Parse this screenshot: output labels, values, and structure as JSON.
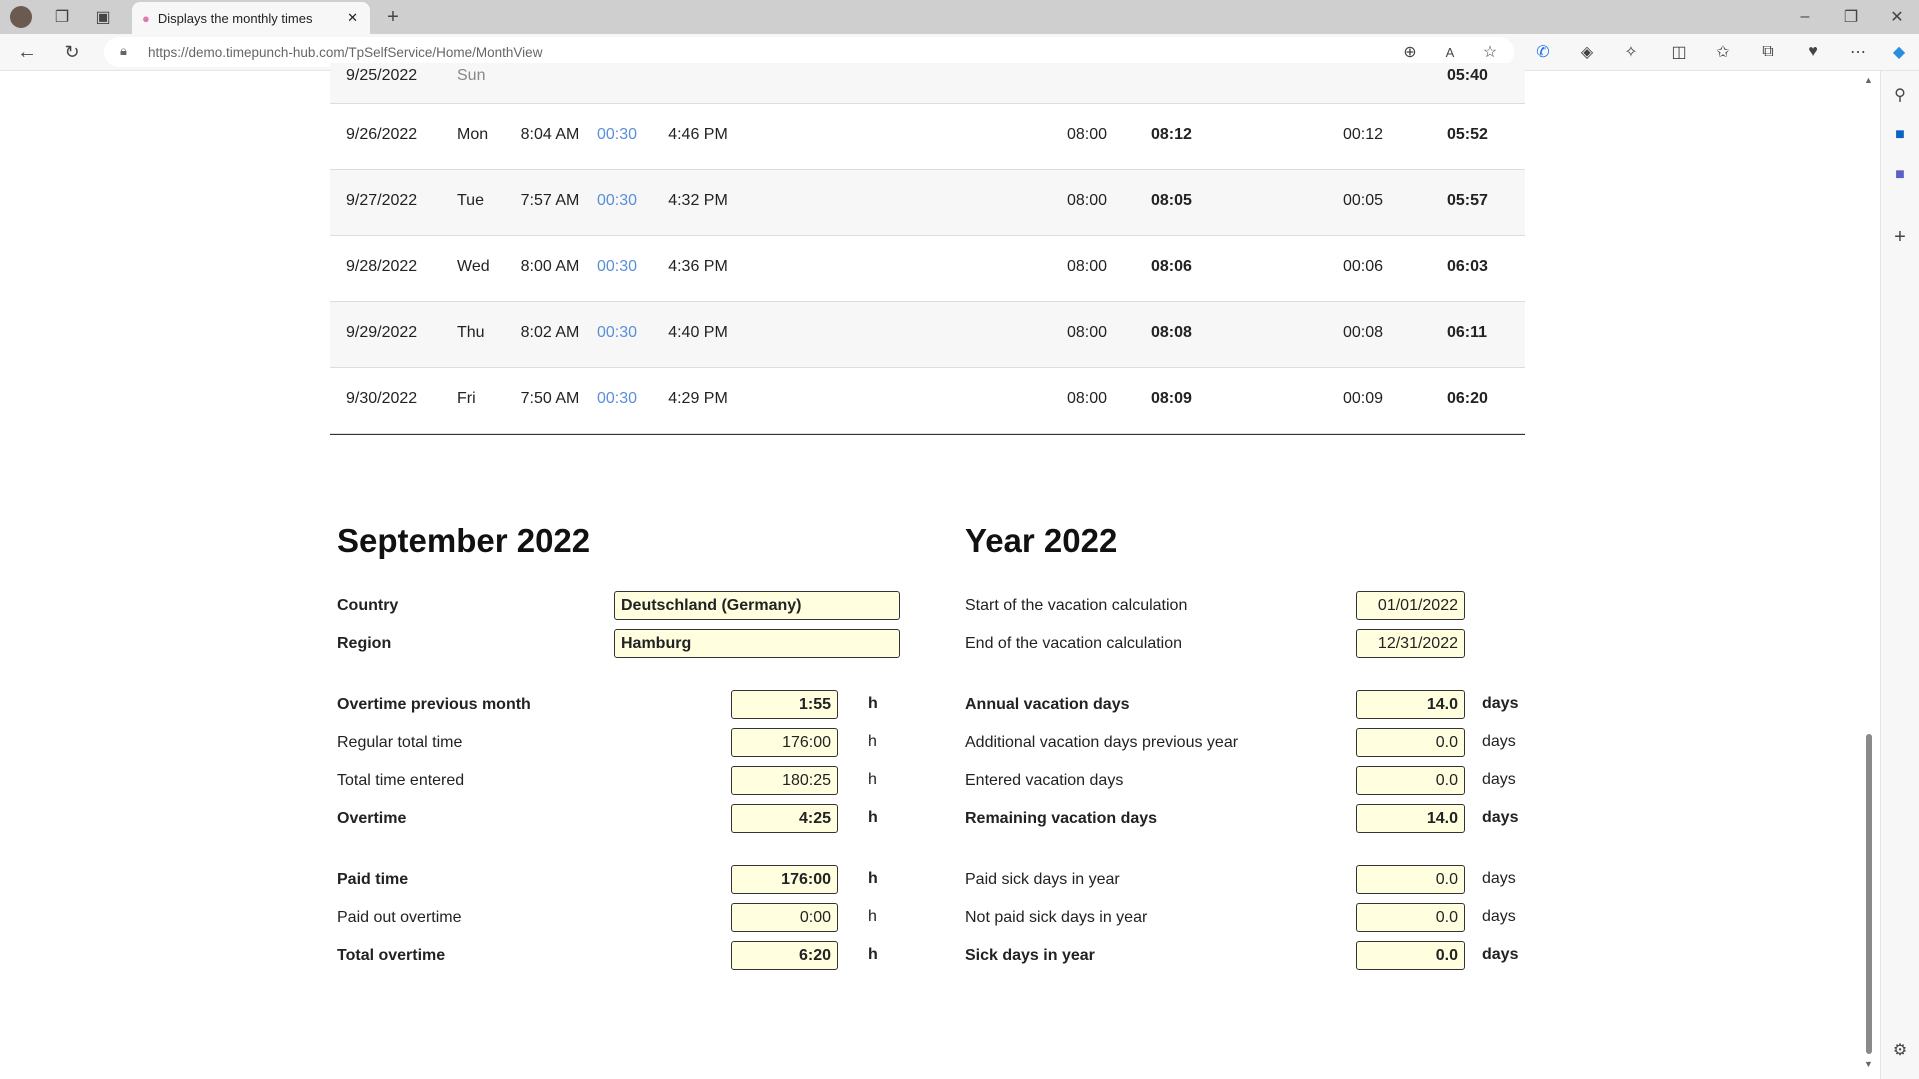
{
  "browser": {
    "tab_title": "Displays the monthly times",
    "url_host": "https://demo.timepunch-hub.com",
    "url_path": "/TpSelfService/Home/MonthView"
  },
  "table": {
    "rows": [
      {
        "date": "9/25/2022",
        "day": "Sun",
        "start": "",
        "break": "",
        "end": "",
        "target": "",
        "actual": "",
        "diff": "",
        "balance": "05:40"
      },
      {
        "date": "9/26/2022",
        "day": "Mon",
        "start": "8:04 AM",
        "break": "00:30",
        "end": "4:46 PM",
        "target": "08:00",
        "actual": "08:12",
        "diff": "00:12",
        "balance": "05:52"
      },
      {
        "date": "9/27/2022",
        "day": "Tue",
        "start": "7:57 AM",
        "break": "00:30",
        "end": "4:32 PM",
        "target": "08:00",
        "actual": "08:05",
        "diff": "00:05",
        "balance": "05:57"
      },
      {
        "date": "9/28/2022",
        "day": "Wed",
        "start": "8:00 AM",
        "break": "00:30",
        "end": "4:36 PM",
        "target": "08:00",
        "actual": "08:06",
        "diff": "00:06",
        "balance": "06:03"
      },
      {
        "date": "9/29/2022",
        "day": "Thu",
        "start": "8:02 AM",
        "break": "00:30",
        "end": "4:40 PM",
        "target": "08:00",
        "actual": "08:08",
        "diff": "00:08",
        "balance": "06:11"
      },
      {
        "date": "9/30/2022",
        "day": "Fri",
        "start": "7:50 AM",
        "break": "00:30",
        "end": "4:29 PM",
        "target": "08:00",
        "actual": "08:09",
        "diff": "00:09",
        "balance": "06:20"
      }
    ]
  },
  "month": {
    "title": "September 2022",
    "country_label": "Country",
    "country": "Deutschland (Germany)",
    "region_label": "Region",
    "region": "Hamburg",
    "items": [
      {
        "label": "Overtime previous month",
        "value": "1:55",
        "unit": "h",
        "bold": true
      },
      {
        "label": "Regular total time",
        "value": "176:00",
        "unit": "h",
        "bold": false
      },
      {
        "label": "Total time entered",
        "value": "180:25",
        "unit": "h",
        "bold": false
      },
      {
        "label": "Overtime",
        "value": "4:25",
        "unit": "h",
        "bold": true
      },
      {
        "label": "Paid time",
        "value": "176:00",
        "unit": "h",
        "bold": true
      },
      {
        "label": "Paid out overtime",
        "value": "0:00",
        "unit": "h",
        "bold": false
      },
      {
        "label": "Total overtime",
        "value": "6:20",
        "unit": "h",
        "bold": true
      }
    ]
  },
  "year": {
    "title": "Year 2022",
    "start_label": "Start of the vacation calculation",
    "start": "01/01/2022",
    "end_label": "End of the vacation calculation",
    "end": "12/31/2022",
    "items": [
      {
        "label": "Annual vacation days",
        "value": "14.0",
        "unit": "days",
        "bold": true
      },
      {
        "label": "Additional vacation days previous year",
        "value": "0.0",
        "unit": "days",
        "bold": false
      },
      {
        "label": "Entered vacation days",
        "value": "0.0",
        "unit": "days",
        "bold": false
      },
      {
        "label": "Remaining vacation days",
        "value": "14.0",
        "unit": "days",
        "bold": true
      },
      {
        "label": "Paid sick days in year",
        "value": "0.0",
        "unit": "days",
        "bold": false
      },
      {
        "label": "Not paid sick days in year",
        "value": "0.0",
        "unit": "days",
        "bold": false
      },
      {
        "label": "Sick days in year",
        "value": "0.0",
        "unit": "days",
        "bold": true
      }
    ]
  }
}
